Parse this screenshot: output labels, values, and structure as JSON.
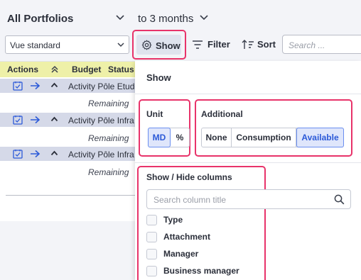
{
  "header": {
    "portfolio": "All Portfolios",
    "period": "to 3 months"
  },
  "toolbar": {
    "view_value": "Vue standard",
    "show_label": "Show",
    "filter_label": "Filter",
    "sort_label": "Sort",
    "search_placeholder": "Search ..."
  },
  "table": {
    "columns": [
      "Actions",
      "Budget",
      "Status"
    ],
    "rows": [
      {
        "name": "Activity Pôle Etudes",
        "remain": "Remaining"
      },
      {
        "name": "Activity Pôle Infra",
        "remain": "Remaining"
      },
      {
        "name": "Activity Pôle Infra",
        "remain": "Remaining"
      }
    ]
  },
  "panel": {
    "title": "Show",
    "unit": {
      "title": "Unit",
      "options": [
        "MD",
        "%"
      ],
      "selected": "MD"
    },
    "additional": {
      "title": "Additional",
      "options": [
        "None",
        "Consumption",
        "Available"
      ],
      "selected": "Available"
    },
    "columns_section": {
      "title": "Show / Hide columns",
      "search_placeholder": "Search column title",
      "items": [
        {
          "label": "Type",
          "checked": false
        },
        {
          "label": "Attachment",
          "checked": false
        },
        {
          "label": "Manager",
          "checked": false
        },
        {
          "label": "Business manager",
          "checked": false
        }
      ]
    }
  },
  "colors": {
    "highlight": "#e8336a",
    "accent": "#2c5ad8",
    "header_row": "#eef0a8",
    "row_bg": "#d5d9e8"
  }
}
